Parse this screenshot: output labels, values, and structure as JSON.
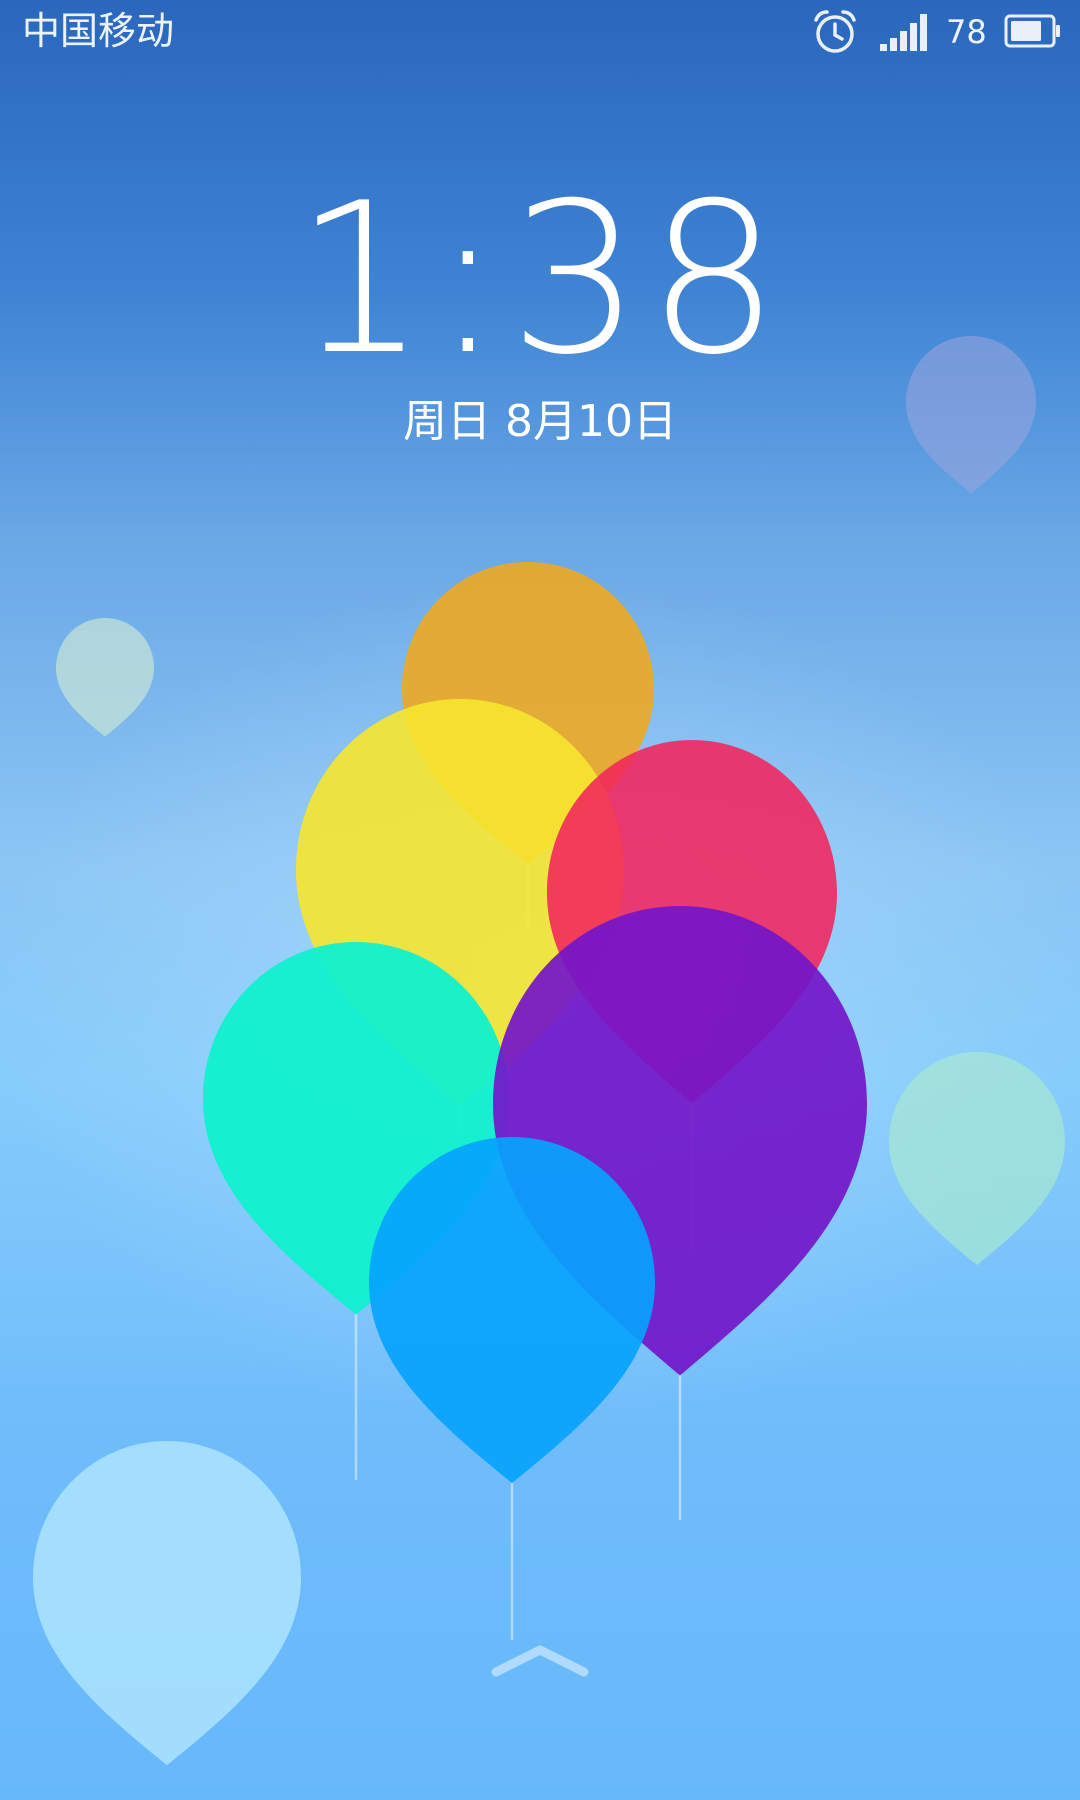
{
  "status_bar": {
    "carrier": "中国移动",
    "battery_level": "78",
    "icons": [
      "alarm-clock-icon",
      "signal-strength-icon",
      "battery-icon"
    ]
  },
  "lock_screen": {
    "time": "1:38",
    "date": "周日  8月10日"
  },
  "wallpaper": {
    "theme": "balloons",
    "balloon_colors": [
      "#f0a81c",
      "#f3e436",
      "#f2335f",
      "#15f0cc",
      "#7a22c8",
      "#0aa5fb"
    ]
  },
  "unlock": {
    "icon": "chevron-up-icon"
  }
}
